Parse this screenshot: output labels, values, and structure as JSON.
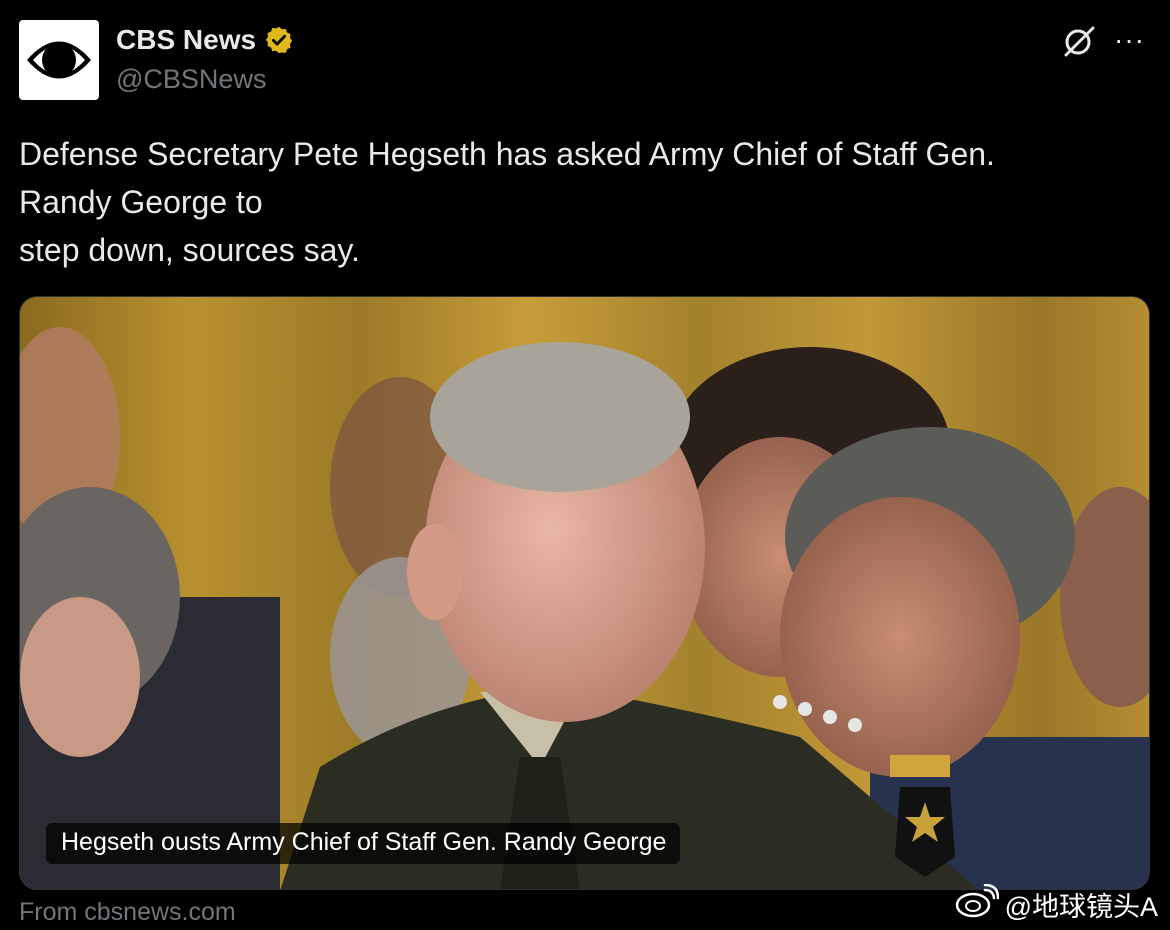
{
  "tweet": {
    "author_name": "CBS News",
    "author_handle": "@CBSNews",
    "avatar_icon": "cbs-eye-logo-icon",
    "verified_icon": "verified-badge-icon",
    "verified_color": "#e2b719",
    "grok_icon": "grok-icon",
    "more_label": "···",
    "text_lines": [
      "Defense Secretary Pete Hegseth has asked Army Chief of Staff Gen.",
      "Randy George to",
      "step down, sources say."
    ]
  },
  "card": {
    "image_description_icon": "news-photo",
    "headline": "Hegseth ousts Army Chief of Staff Gen. Randy George",
    "source": "From cbsnews.com"
  },
  "watermark": {
    "icon": "weibo-logo-icon",
    "text": "@地球镜头A"
  },
  "colors": {
    "background": "#000000",
    "text": "#e7e9ea",
    "muted": "#71767b"
  }
}
